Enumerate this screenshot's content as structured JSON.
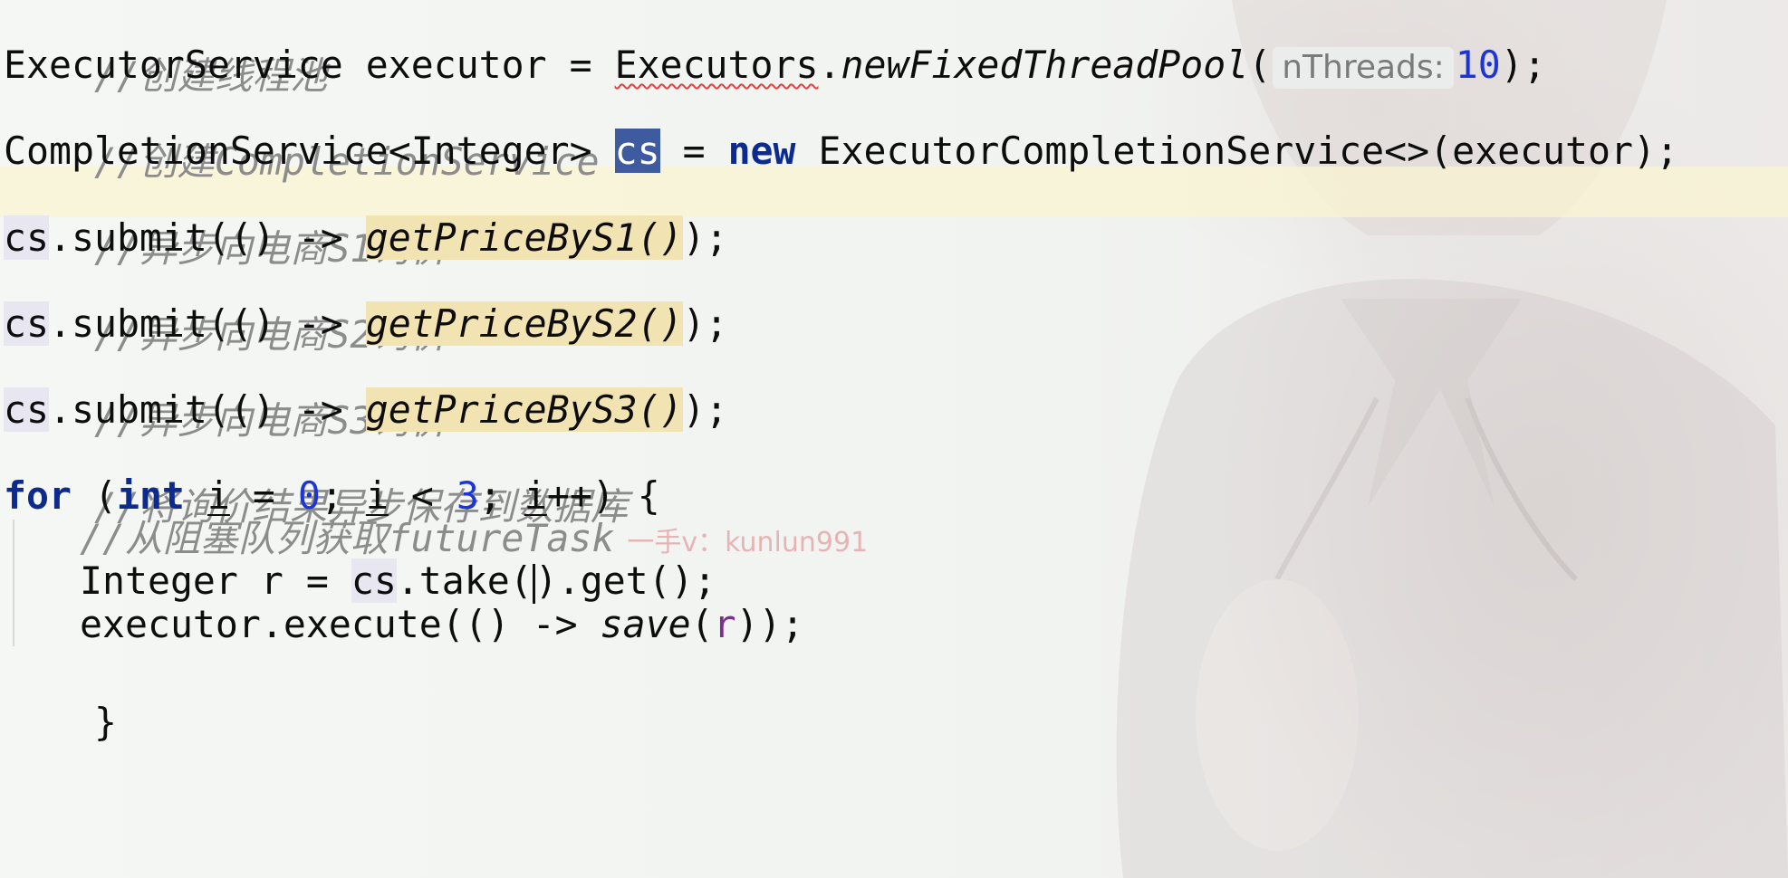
{
  "editor": {
    "language": "Java",
    "comments": {
      "create_thread_pool": "//创建线程池",
      "create_completion_service": "//创建CompletionService",
      "query_s1": "//异步向电商S1询价",
      "query_s2": "//异步向电商S2询价",
      "query_s3": "//异步向电商S3询价",
      "save_async": "//将询价结果异步保存到数据库",
      "take_from_queue": "//从阻塞队列获取futureTask"
    },
    "code": {
      "l2_type": "ExecutorService executor = ",
      "l2_class": "Executors",
      "l2_dot": ".",
      "l2_method": "newFixedThreadPool",
      "l2_open": "(",
      "l2_hint": "nThreads:",
      "l2_arg": "10",
      "l2_close": ");",
      "l4_type": "CompletionService<Integer> ",
      "l4_var": "cs",
      "l4_assign": " = ",
      "l4_new": "new",
      "l4_rest": " ExecutorCompletionService<>(executor);",
      "submit_prefix_var": "cs",
      "submit_prefix_rest": ".submit(() -> ",
      "s1_call": "getPriceByS1()",
      "s2_call": "getPriceByS2()",
      "s3_call": "getPriceByS3()",
      "submit_suffix": ");",
      "for_kw": "for",
      "for_open": " (",
      "for_int": "int",
      "for_space": " ",
      "for_i1": "i",
      "for_eq": " = ",
      "for_zero": "0",
      "for_semi1": "; ",
      "for_i2": "i",
      "for_lt": " < ",
      "for_three": "3",
      "for_semi2": "; ",
      "for_i3": "i",
      "for_end": "++) {",
      "l14_type": "Integer r = ",
      "l14_var": "cs",
      "l14_mid1": ".take(",
      "l14_mid2": ").get();",
      "l15_a": "executor.execute(() -> ",
      "l15_method": "save",
      "l15_open": "(",
      "l15_arg": "r",
      "l15_close": "));",
      "close_brace": "}"
    },
    "watermark": "一手v：kunlun991"
  },
  "colors": {
    "keyword": "#0c2b8c",
    "number": "#1b35d6",
    "comment": "#8c8c8c",
    "selection": "#3d5b9e",
    "method_highlight": "#f2e3b3",
    "current_line": "#faf4d2"
  }
}
